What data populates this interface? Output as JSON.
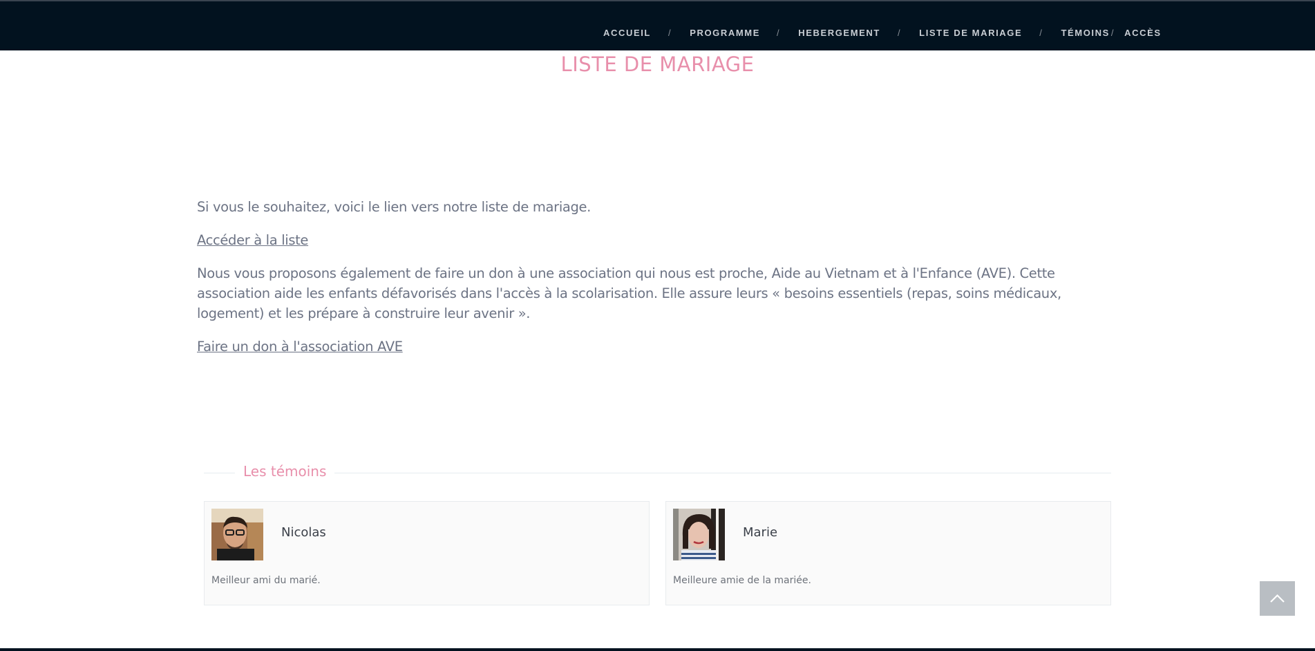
{
  "nav": {
    "items": [
      "ACCUEIL",
      "PROGRAMME",
      "HEBERGEMENT",
      "LISTE DE MARIAGE",
      "TÉMOINS",
      "ACCÈS"
    ],
    "separator": "/"
  },
  "page": {
    "title": "LISTE DE MARIAGE"
  },
  "content": {
    "intro": "Si vous le souhaitez, voici le lien vers notre liste de mariage.",
    "list_link": "Accéder à la liste",
    "donation_text": "Nous vous proposons également de faire un don à une association qui nous est proche, Aide au Vietnam et à l'Enfance (AVE). Cette association aide les enfants défavorisés dans l'accès à la scolarisation. Elle assure leurs « besoins essentiels (repas, soins médicaux, logement) et les prépare à construire leur avenir ».",
    "donation_link": "Faire un don à l'association AVE"
  },
  "temoins": {
    "heading": "Les témoins",
    "cards": [
      {
        "name": "Nicolas",
        "description": "Meilleur ami du marié."
      },
      {
        "name": "Marie",
        "description": "Meilleure amie de la mariée."
      }
    ]
  },
  "icons": {
    "back_to_top": "chevron-up-icon"
  },
  "colors": {
    "nav_bg": "#02121f",
    "accent_pink": "#e88fab",
    "body_text": "#6c7384"
  }
}
